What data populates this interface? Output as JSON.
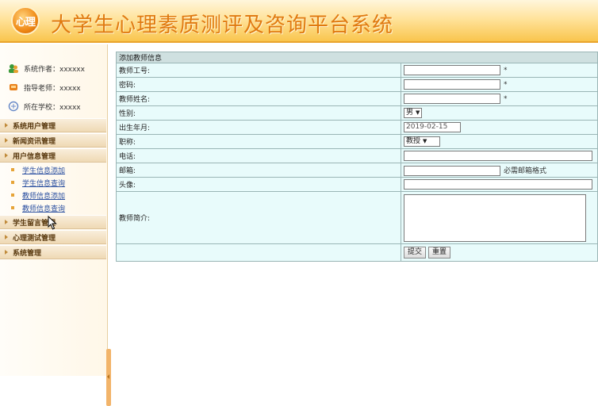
{
  "app": {
    "title": "大学生心理素质测评及咨询平台系统",
    "logo_text": "心理"
  },
  "sidebar": {
    "info": [
      {
        "icon": "users-icon",
        "text": "系统作者：xxxxxx"
      },
      {
        "icon": "teacher-icon",
        "text": "指导老师：xxxxx"
      },
      {
        "icon": "school-icon",
        "text": "所在学校：xxxxx"
      }
    ],
    "menu": [
      {
        "label": "系统用户管理"
      },
      {
        "label": "新闻资讯管理"
      },
      {
        "label": "用户信息管理"
      },
      {
        "label": "学生留言管理"
      },
      {
        "label": "心理测试管理"
      },
      {
        "label": "系统管理"
      }
    ],
    "user_info_sub": [
      "学生信息添加",
      "学生信息查询",
      "教师信息添加",
      "教师信息查询"
    ]
  },
  "form": {
    "caption": "添加教师信息",
    "fields": {
      "teacher_id": {
        "label": "教师工号:",
        "value": "",
        "required_mark": "*"
      },
      "password": {
        "label": "密码:",
        "value": "",
        "required_mark": "*"
      },
      "name": {
        "label": "教师姓名:",
        "value": "",
        "required_mark": "*"
      },
      "gender": {
        "label": "性别:",
        "value": "男"
      },
      "birth": {
        "label": "出生年月:",
        "value": "2019-02-15"
      },
      "title": {
        "label": "职称:",
        "value": "教授"
      },
      "phone": {
        "label": "电话:",
        "value": ""
      },
      "email": {
        "label": "邮箱:",
        "value": "",
        "hint": "必需邮箱格式"
      },
      "avatar": {
        "label": "头像:",
        "value": ""
      },
      "intro": {
        "label": "教师简介:",
        "value": ""
      }
    },
    "buttons": {
      "submit": "提交",
      "reset": "重置"
    }
  }
}
